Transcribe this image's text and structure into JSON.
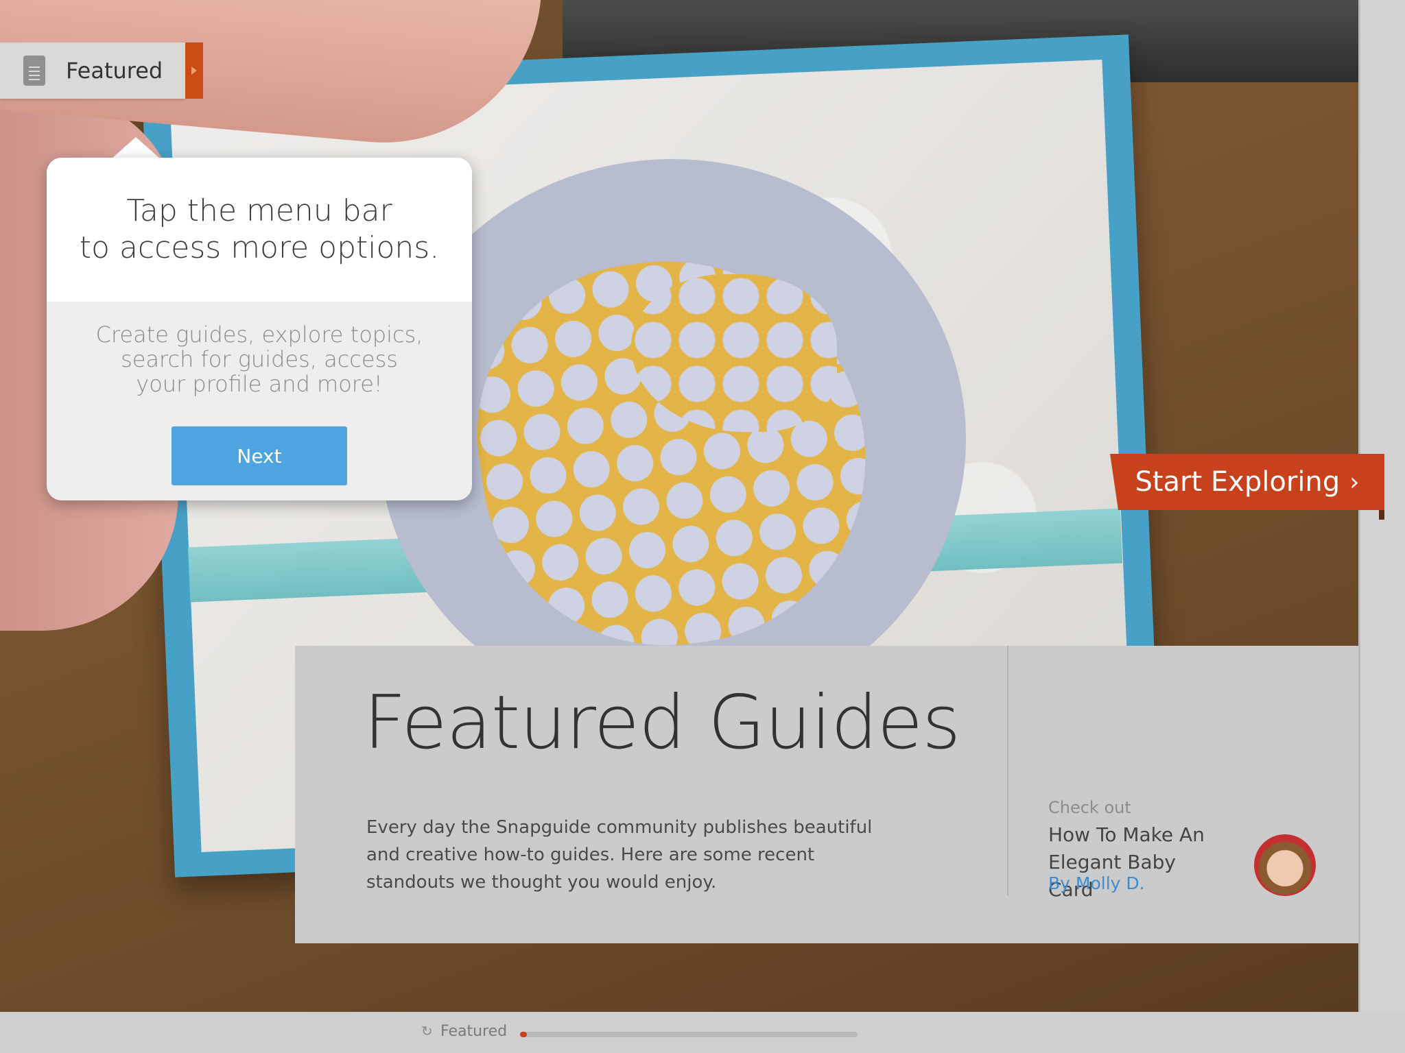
{
  "menu": {
    "label": "Featured",
    "icon": "document-list-icon"
  },
  "tooltip": {
    "headline_line1": "Tap the menu bar",
    "headline_line2": "to access more options.",
    "body_line1": "Create guides, explore topics,",
    "body_line2": "search for guides, access",
    "body_line3": "your profile and more!",
    "next_label": "Next"
  },
  "start_exploring": {
    "label": "Start Exploring",
    "chevron": "›"
  },
  "featured": {
    "title": "Featured Guides",
    "description": "Every day the Snapguide community publishes beautiful and creative how-to guides. Here are some recent standouts we thought you would enjoy.",
    "check_out_label": "Check out",
    "guide_title": "How To Make An Elegant Baby Card",
    "guide_author": "By Molly D."
  },
  "status_bar": {
    "label": "Featured",
    "icon": "refresh-icon",
    "progress": 0.02
  },
  "colors": {
    "accent": "#c7421c",
    "button_blue": "#4ea4e0",
    "link_blue": "#3d8bd0"
  }
}
